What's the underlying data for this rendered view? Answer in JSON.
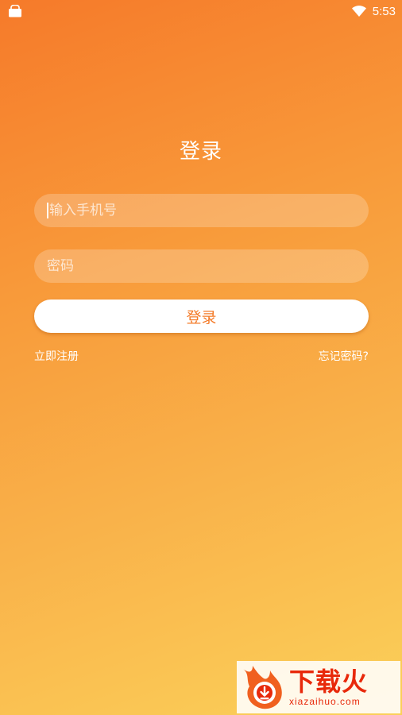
{
  "status_bar": {
    "time": "5:53",
    "left_icon": "shopping-bag-icon",
    "right_icon": "wifi-icon"
  },
  "login": {
    "title": "登录",
    "phone_placeholder": "输入手机号",
    "password_placeholder": "密码",
    "submit_label": "登录",
    "register_link": "立即注册",
    "forgot_link": "忘记密码?"
  },
  "watermark": {
    "title": "下载火",
    "url": "xiazaihuo.com"
  },
  "colors": {
    "gradient_start": "#f67a2a",
    "gradient_end": "#fbd059",
    "accent": "#f47a27",
    "watermark_red": "#e8290b"
  }
}
